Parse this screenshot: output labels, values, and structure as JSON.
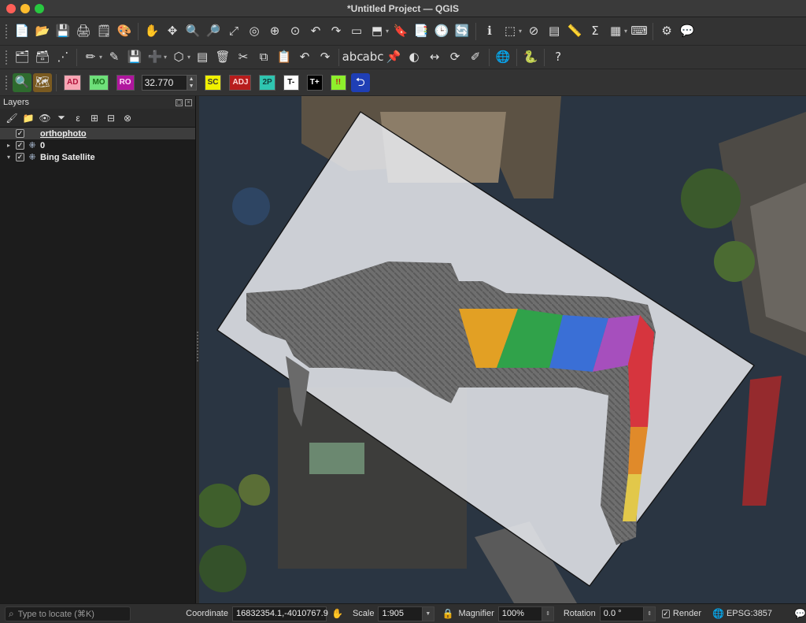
{
  "window": {
    "title": "*Untitled Project — QGIS"
  },
  "toolbar1": {
    "buttons": [
      {
        "name": "new-project-icon",
        "glyph": "📄"
      },
      {
        "name": "open-project-icon",
        "glyph": "📂"
      },
      {
        "name": "save-project-icon",
        "glyph": "💾"
      },
      {
        "name": "new-print-layout-icon",
        "glyph": "🖨"
      },
      {
        "name": "show-layout-manager-icon",
        "glyph": "🗒"
      },
      {
        "name": "style-manager-icon",
        "glyph": "🎨"
      },
      {
        "name": "pan-map-icon",
        "glyph": "✋"
      },
      {
        "name": "pan-to-selection-icon",
        "glyph": "✥"
      },
      {
        "name": "zoom-in-icon",
        "glyph": "🔍"
      },
      {
        "name": "zoom-out-icon",
        "glyph": "🔎"
      },
      {
        "name": "zoom-full-icon",
        "glyph": "⤢"
      },
      {
        "name": "zoom-to-selection-icon",
        "glyph": "◎"
      },
      {
        "name": "zoom-to-layer-icon",
        "glyph": "⊕"
      },
      {
        "name": "zoom-native-resolution-icon",
        "glyph": "⊙"
      },
      {
        "name": "zoom-last-icon",
        "glyph": "↶"
      },
      {
        "name": "zoom-next-icon",
        "glyph": "↷"
      },
      {
        "name": "new-map-view-icon",
        "glyph": "▭"
      },
      {
        "name": "new-3d-map-view-icon",
        "glyph": "⬒"
      },
      {
        "name": "new-bookmark-icon",
        "glyph": "🔖"
      },
      {
        "name": "show-bookmarks-icon",
        "glyph": "📑"
      },
      {
        "name": "temporal-controller-icon",
        "glyph": "🕒"
      },
      {
        "name": "refresh-icon",
        "glyph": "🔄"
      },
      {
        "name": "identify-features-icon",
        "glyph": "ℹ"
      },
      {
        "name": "select-features-icon",
        "glyph": "⬚"
      },
      {
        "name": "deselect-features-icon",
        "glyph": "⊘"
      },
      {
        "name": "select-by-value-icon",
        "glyph": "▤"
      },
      {
        "name": "measure-icon",
        "glyph": "📏"
      },
      {
        "name": "statistical-summary-icon",
        "glyph": "Σ"
      },
      {
        "name": "attribute-table-icon",
        "glyph": "▦"
      },
      {
        "name": "field-calculator-icon",
        "glyph": "⌨"
      },
      {
        "name": "gear-icon",
        "glyph": "⚙"
      },
      {
        "name": "map-tips-icon",
        "glyph": "💬"
      }
    ]
  },
  "toolbar2": {
    "buttons": [
      {
        "name": "data-source-manager-icon",
        "glyph": "🗂"
      },
      {
        "name": "new-geopackage-layer-icon",
        "glyph": "🗃"
      },
      {
        "name": "new-temporary-layer-icon",
        "glyph": "⋰"
      },
      {
        "name": "digitize-icon",
        "glyph": "✏"
      },
      {
        "name": "toggle-editing-icon",
        "glyph": "✎"
      },
      {
        "name": "save-edits-icon",
        "glyph": "💾"
      },
      {
        "name": "add-feature-icon",
        "glyph": "➕"
      },
      {
        "name": "vertex-tool-icon",
        "glyph": "⬡"
      },
      {
        "name": "modify-attributes-icon",
        "glyph": "▤"
      },
      {
        "name": "delete-selected-icon",
        "glyph": "🗑"
      },
      {
        "name": "cut-features-icon",
        "glyph": "✂"
      },
      {
        "name": "copy-features-icon",
        "glyph": "⧉"
      },
      {
        "name": "paste-features-icon",
        "glyph": "📋"
      },
      {
        "name": "undo-icon",
        "glyph": "↶"
      },
      {
        "name": "redo-icon",
        "glyph": "↷"
      },
      {
        "name": "label-tool-icon",
        "glyph": "abc"
      },
      {
        "name": "label-options-icon",
        "glyph": "abc"
      },
      {
        "name": "pin-labels-icon",
        "glyph": "📌"
      },
      {
        "name": "show-hide-labels-icon",
        "glyph": "◐"
      },
      {
        "name": "move-label-icon",
        "glyph": "↔"
      },
      {
        "name": "rotate-label-icon",
        "glyph": "⟳"
      },
      {
        "name": "change-label-icon",
        "glyph": "✐"
      },
      {
        "name": "add-wms-layer-icon",
        "glyph": "🌐"
      },
      {
        "name": "python-console-icon",
        "glyph": "🐍"
      },
      {
        "name": "help-icon",
        "glyph": "?"
      }
    ]
  },
  "toolbar3": {
    "search_icon": "🔍",
    "layer_icon": "🗺",
    "chips": [
      {
        "name": "ad-button",
        "label": "AD",
        "bg": "#f7a6b4",
        "fg": "#b0123a"
      },
      {
        "name": "mo-button",
        "label": "MO",
        "bg": "#6ee07a",
        "fg": "#1a6d1a"
      },
      {
        "name": "ro-button",
        "label": "RO",
        "bg": "#b0169e",
        "fg": "#ffe0fb"
      }
    ],
    "value": "32.770",
    "chips2": [
      {
        "name": "sc-button",
        "label": "SC",
        "bg": "#f0f000",
        "fg": "#333"
      },
      {
        "name": "adj-button",
        "label": "ADJ",
        "bg": "#b71c1c",
        "fg": "#ffd6d6"
      },
      {
        "name": "2p-button",
        "label": "2P",
        "bg": "#2fc5b0",
        "fg": "#0e3f3a"
      },
      {
        "name": "t-minus-button",
        "label": "T-",
        "bg": "#ffffff",
        "fg": "#000"
      },
      {
        "name": "t-plus-button",
        "label": "T+",
        "bg": "#000000",
        "fg": "#fff"
      },
      {
        "name": "exclaim-button",
        "label": "!!",
        "bg": "#8ef02c",
        "fg": "#b71c1c"
      }
    ],
    "back_icon": "⮌"
  },
  "layers": {
    "title": "Layers",
    "tools": [
      {
        "name": "open-layer-styling-icon",
        "glyph": "🖌"
      },
      {
        "name": "add-group-icon",
        "glyph": "📁"
      },
      {
        "name": "manage-visibility-icon",
        "glyph": "👁"
      },
      {
        "name": "filter-legend-icon",
        "glyph": "⏷"
      },
      {
        "name": "filter-expression-icon",
        "glyph": "ε"
      },
      {
        "name": "expand-all-icon",
        "glyph": "⊞"
      },
      {
        "name": "collapse-all-icon",
        "glyph": "⊟"
      },
      {
        "name": "remove-layer-icon",
        "glyph": "⊗"
      }
    ],
    "items": [
      {
        "label": "orthophoto",
        "checked": "✓",
        "twisty": "",
        "icon": ""
      },
      {
        "label": "0",
        "checked": "✓",
        "twisty": "▸",
        "icon": "⁜"
      },
      {
        "label": "Bing Satellite",
        "checked": "✓",
        "twisty": "▾",
        "icon": "⁜"
      }
    ]
  },
  "status": {
    "locate_placeholder": "Type to locate (⌘K)",
    "coordinate_label": "Coordinate",
    "coordinate_value": "16832354.1,-4010767.9",
    "scale_label": "Scale",
    "scale_value": "1:905",
    "magnifier_label": "Magnifier",
    "magnifier_value": "100%",
    "rotation_label": "Rotation",
    "rotation_value": "0.0 °",
    "render_label": "Render",
    "crs_value": "EPSG:3857"
  }
}
